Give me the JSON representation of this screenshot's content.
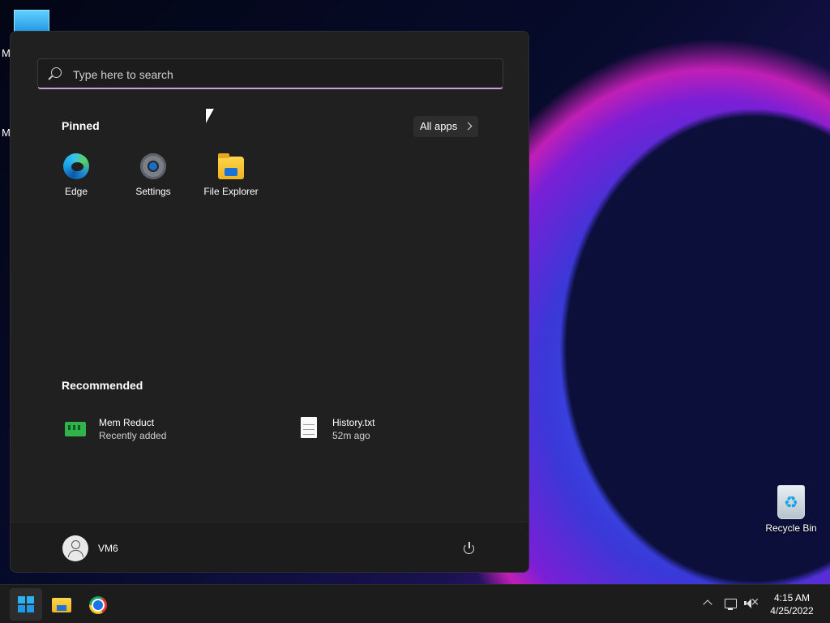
{
  "desktop": {
    "partial_labels": [
      "M",
      "M"
    ],
    "recycle_bin_label": "Recycle Bin"
  },
  "start_menu": {
    "search_placeholder": "Type here to search",
    "pinned_title": "Pinned",
    "all_apps_label": "All apps",
    "pinned_apps": [
      {
        "label": "Edge",
        "icon": "edge-icon"
      },
      {
        "label": "Settings",
        "icon": "settings-gear-icon"
      },
      {
        "label": "File Explorer",
        "icon": "folder-icon"
      }
    ],
    "recommended_title": "Recommended",
    "recommended": [
      {
        "name": "Mem Reduct",
        "subtitle": "Recently added",
        "icon": "memory-chip-icon"
      },
      {
        "name": "History.txt",
        "subtitle": "52m ago",
        "icon": "text-file-icon"
      }
    ],
    "user_name": "VM6"
  },
  "taskbar": {
    "apps": [
      {
        "name": "Start",
        "icon": "windows-logo-icon"
      },
      {
        "name": "File Explorer",
        "icon": "folder-icon"
      },
      {
        "name": "Chrome",
        "icon": "chrome-icon"
      }
    ],
    "tray": {
      "time": "4:15 AM",
      "date": "4/25/2022"
    }
  }
}
